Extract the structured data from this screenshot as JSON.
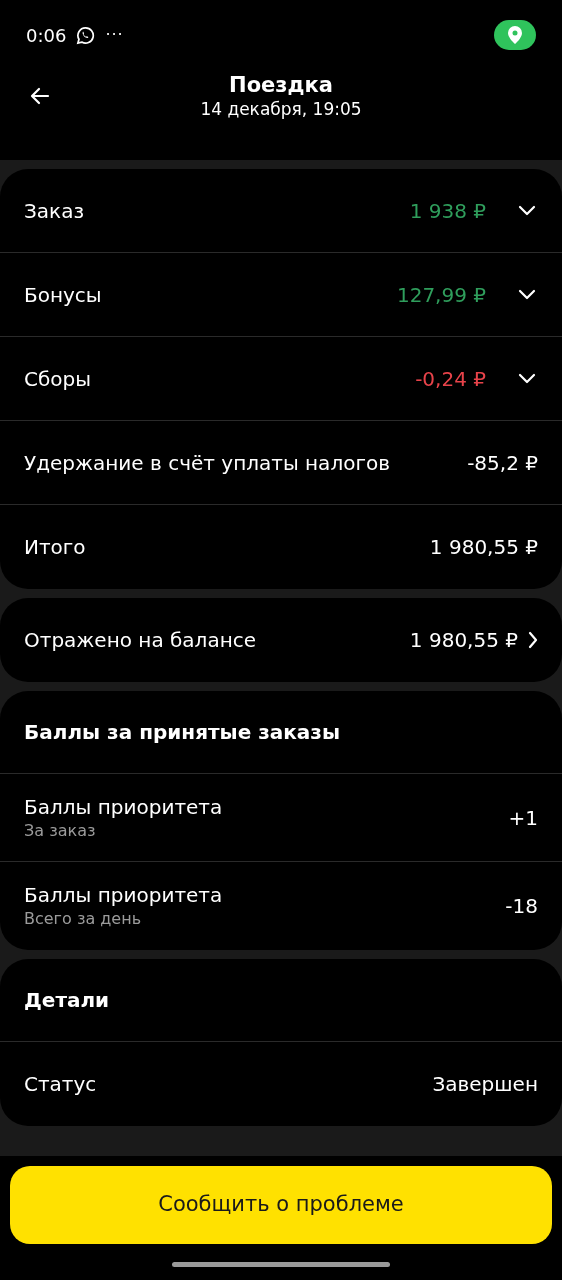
{
  "status_bar": {
    "time": "0:06",
    "more": "···"
  },
  "header": {
    "title": "Поездка",
    "subtitle": "14 декабря, 19:05"
  },
  "sections": [
    {
      "rows": [
        {
          "kind": "expandable",
          "label": "Заказ",
          "value": "1 938 ₽",
          "color": "#2f9e5c",
          "expanded": false
        },
        {
          "kind": "expandable",
          "label": "Бонусы",
          "value": "127,99 ₽",
          "color": "#2f9e5c",
          "expanded": false
        },
        {
          "kind": "expandable",
          "label": "Сборы",
          "value": "-0,24 ₽",
          "color": "#e8434a",
          "expanded": false
        },
        {
          "kind": "plain",
          "label": "Удержание в счёт уплаты налогов",
          "value": "-85,2 ₽",
          "color": "#ffffff"
        },
        {
          "kind": "plain",
          "label": "Итого",
          "value": "1 980,55 ₽",
          "color": "#ffffff"
        }
      ]
    },
    {
      "rows": [
        {
          "kind": "link",
          "label": "Отражено на балансе",
          "value": "1 980,55 ₽",
          "color": "#ffffff"
        }
      ]
    },
    {
      "title": "Баллы за принятые заказы",
      "rows": [
        {
          "kind": "plain",
          "label": "Баллы приоритета",
          "sublabel": "За заказ",
          "value": "+1",
          "color": "#ffffff"
        },
        {
          "kind": "plain",
          "label": "Баллы приоритета",
          "sublabel": "Всего за день",
          "value": "-18",
          "color": "#ffffff"
        }
      ]
    },
    {
      "title": "Детали",
      "rows": [
        {
          "kind": "plain",
          "label": "Статус",
          "value": "Завершен",
          "color": "#ffffff"
        }
      ]
    }
  ],
  "action_button": "Сообщить о проблеме"
}
